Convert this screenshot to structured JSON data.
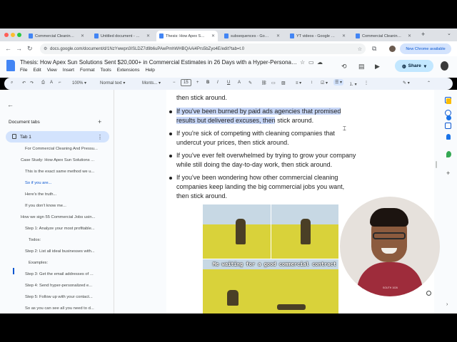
{
  "browser": {
    "tabs": [
      {
        "title": "Commercial Cleaning Le",
        "active": false
      },
      {
        "title": "Untitled document - Goo",
        "active": false
      },
      {
        "title": "Thesis: How Apex Sun S",
        "active": true
      },
      {
        "title": "subsequences - Google",
        "active": false
      },
      {
        "title": "YT videos - Google Doc",
        "active": false
      },
      {
        "title": "Commercial Cleaning pr",
        "active": false
      }
    ],
    "url": "docs.google.com/document/d/1NzYwwpn3ISLDZ7d9b6uPAwPmhWHBQAAi4Prs5bZyo4E/edit?tab=t.0",
    "chrome_status": "New Chrome available"
  },
  "docs": {
    "title": "Thesis: How Apex Sun Solutions Sent $20,000+ in Commercial Estimates in 26 Days with a Hyper-Personali...",
    "menus": [
      "File",
      "Edit",
      "View",
      "Insert",
      "Format",
      "Tools",
      "Extensions",
      "Help"
    ],
    "share_label": "Share",
    "toolbar": {
      "zoom": "100%",
      "style": "Normal text",
      "font": "Monts...",
      "font_size": "15"
    }
  },
  "sidebar": {
    "heading": "Document tabs",
    "tab_name": "Tab 1",
    "outline": [
      {
        "label": "For Commercial Cleaning And Pressu...",
        "level": 2,
        "active": false
      },
      {
        "label": "Case Study: How Apex Sun Solutions ...",
        "level": 1,
        "active": false
      },
      {
        "label": "This is the exact same method we u...",
        "level": 2,
        "active": false
      },
      {
        "label": "So if you are...",
        "level": 2,
        "active": true
      },
      {
        "label": "Here's the truth...",
        "level": 2,
        "active": false
      },
      {
        "label": "If you don't know me...",
        "level": 2,
        "active": false
      },
      {
        "label": "How we sign 55 Commercial Jobs usin...",
        "level": 1,
        "active": false
      },
      {
        "label": "Step 1: Analyze your most profitable...",
        "level": 2,
        "active": false
      },
      {
        "label": "Todos:",
        "level": 3,
        "active": false
      },
      {
        "label": "Step 2: List all ideal businesses with...",
        "level": 2,
        "active": false
      },
      {
        "label": "Examples:",
        "level": 3,
        "active": false
      },
      {
        "label": "Step 3: Get the email addresses of ...",
        "level": 2,
        "active": false
      },
      {
        "label": "Step 4: Send hyper-personalized e...",
        "level": 2,
        "active": false
      },
      {
        "label": "Step 5: Follow up with your contact...",
        "level": 2,
        "active": false
      },
      {
        "label": "So as you can see all you need to d...",
        "level": 2,
        "active": false
      }
    ]
  },
  "document": {
    "top_line": "then stick around.",
    "bullets": [
      {
        "lines": [
          "If you've been burned by paid ads agencies that promised",
          "results but delivered excuses, then stick around."
        ],
        "highlighted": true
      },
      {
        "lines": [
          "If you're sick of competing with cleaning companies that",
          "undercut your prices, then stick around."
        ],
        "highlighted": false
      },
      {
        "lines": [
          "If you've ever felt overwhelmed by trying to grow your company",
          "while still doing the day-to-day work, then stick around."
        ],
        "highlighted": false
      },
      {
        "lines": [
          "If you've been wondering how other commercial cleaning",
          "companies keep landing the big commercial jobs you want,",
          "then stick around."
        ],
        "highlighted": false
      }
    ],
    "meme_caption": "Me waiting for a good commercial contract"
  },
  "webcam": {
    "shirt_text": "SOUTH 1026"
  },
  "colors": {
    "accent": "#0b57d0",
    "highlight": "#c8d7f7",
    "share_bg": "#c2e7ff"
  }
}
